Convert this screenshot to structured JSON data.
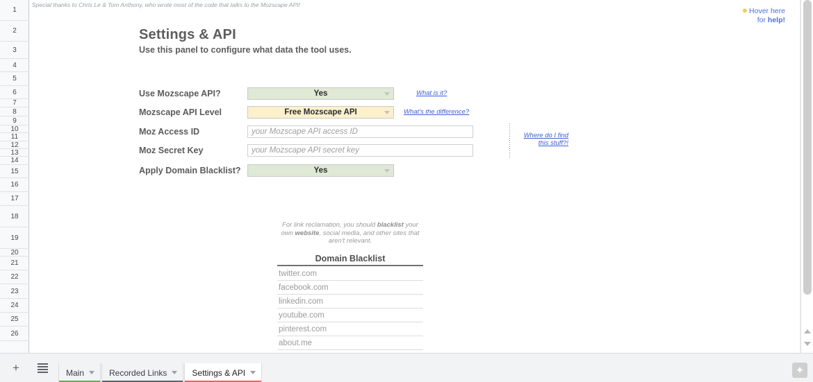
{
  "sheet": {
    "credit_note": "Special thanks to Chris Le & Tom Anthony, who wrote most of the code that talks to the Mozscape API!",
    "help_hint_line1": "Hover here",
    "help_hint_line2_prefix": "for ",
    "help_hint_line2_bold": "help!",
    "star_icon": "sparkle-icon",
    "row_numbers": [
      "1",
      "2",
      "3",
      "4",
      "5",
      "6",
      "7",
      "8",
      "9",
      "10",
      "11",
      "12",
      "13",
      "14",
      "15",
      "16",
      "17",
      "18",
      "19",
      "20",
      "21",
      "22",
      "23",
      "24",
      "25",
      "26"
    ]
  },
  "panel": {
    "title": "Settings & API",
    "subtitle": "Use this panel to configure what data the tool uses."
  },
  "form": {
    "rows": [
      {
        "label": "Use Mozscape API?",
        "control": "select",
        "value": "Yes",
        "style": "green",
        "link": "What is it?"
      },
      {
        "label": "Mozscape API Level",
        "control": "select",
        "value": "Free Mozscape API",
        "style": "yellow",
        "link": "What's the difference?"
      },
      {
        "label": "Moz Access ID",
        "control": "text",
        "value": "",
        "placeholder": "your Mozscape API access ID",
        "link": ""
      },
      {
        "label": "Moz Secret Key",
        "control": "text",
        "value": "",
        "placeholder": "your Mozscape API secret key",
        "link": ""
      },
      {
        "label": "Apply Domain Blacklist?",
        "control": "select",
        "value": "Yes",
        "style": "green",
        "link": ""
      }
    ],
    "side_link_line1": "Where do I find",
    "side_link_line2": "this stuff?!"
  },
  "blacklist": {
    "note_part1": "For link reclamation, you should ",
    "note_bold1": "blacklist",
    "note_part2": " your own ",
    "note_bold2": "website",
    "note_part3": ", social media, and other sites that aren't relevant.",
    "header": "Domain Blacklist",
    "domains": [
      "twitter.com",
      "facebook.com",
      "linkedin.com",
      "youtube.com",
      "pinterest.com",
      "about.me"
    ]
  },
  "bottom_bar": {
    "add_sheet_label": "+",
    "all_sheets_label": "all-sheets-icon",
    "tabs": [
      {
        "label": "Main",
        "active": false,
        "color": "#6aa84f"
      },
      {
        "label": "Recorded Links",
        "active": false,
        "color": "#5f6368"
      },
      {
        "label": "Settings & API",
        "active": true,
        "color": "#e06666"
      }
    ],
    "resize_glyph": "✦"
  }
}
